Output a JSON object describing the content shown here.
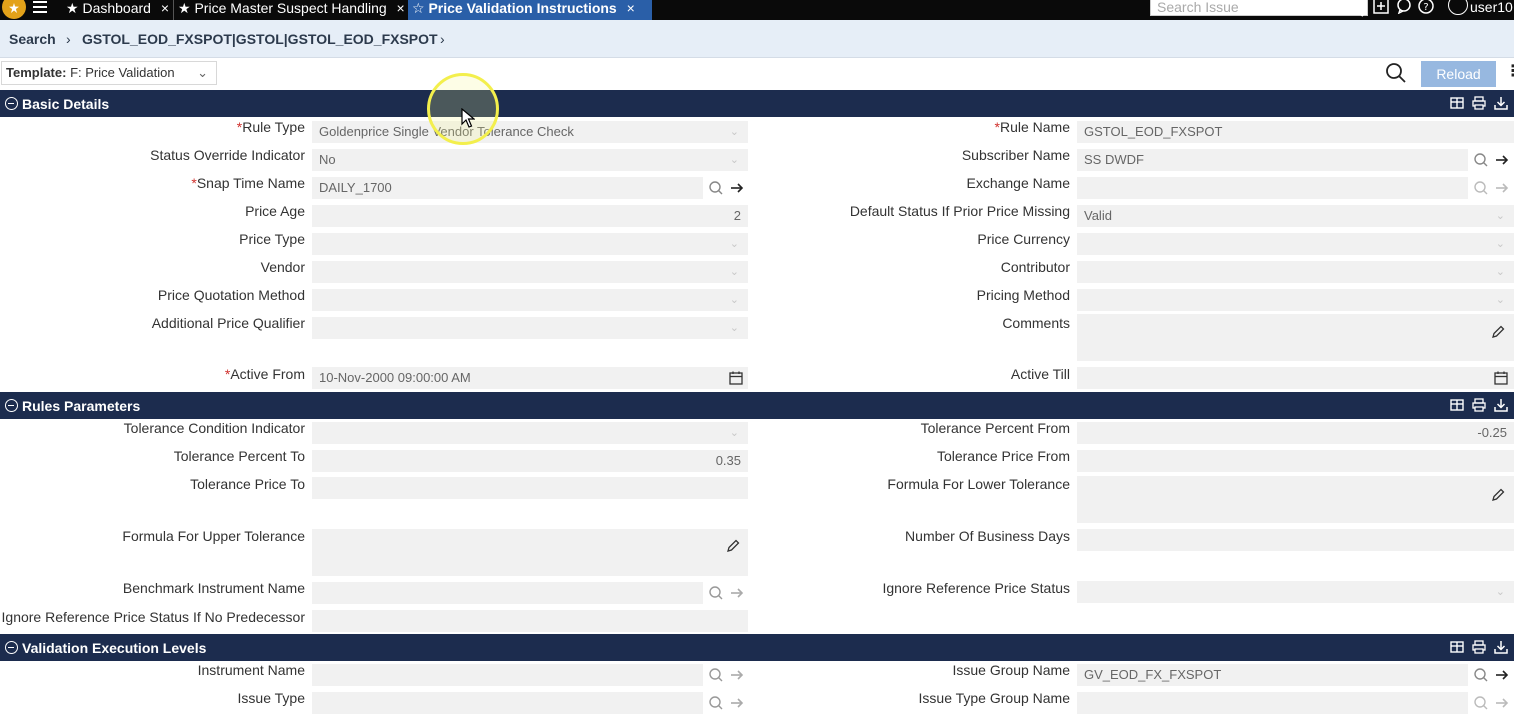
{
  "tabs": [
    {
      "label": "Dashboard",
      "close": "×"
    },
    {
      "label": "Price Master Suspect Handling",
      "close": "×"
    },
    {
      "label": "Price Validation Instructions",
      "close": "×"
    }
  ],
  "topbar": {
    "search_placeholder": "Search Issue",
    "user": "user10"
  },
  "breadcrumb": {
    "root": "Search",
    "current": "GSTOL_EOD_FXSPOT|GSTOL|GSTOL_EOD_FXSPOT"
  },
  "template": {
    "label": "Template:",
    "value": "F: Price Validation"
  },
  "reload_label": "Reload",
  "sections": {
    "basic": "Basic Details",
    "rules": "Rules Parameters",
    "exec": "Validation Execution Levels"
  },
  "basic": {
    "rule_type": {
      "label": "Rule Type",
      "value": "Goldenprice Single Vendor Tolerance Check"
    },
    "status_override": {
      "label": "Status Override Indicator",
      "value": "No"
    },
    "snap_time": {
      "label": "Snap Time Name",
      "value": "DAILY_1700"
    },
    "price_age": {
      "label": "Price Age",
      "value": "2"
    },
    "price_type": {
      "label": "Price Type",
      "value": ""
    },
    "vendor": {
      "label": "Vendor",
      "value": ""
    },
    "price_quotation": {
      "label": "Price Quotation Method",
      "value": ""
    },
    "additional_qualifier": {
      "label": "Additional Price Qualifier",
      "value": ""
    },
    "active_from": {
      "label": "Active From",
      "value": "10-Nov-2000 09:00:00 AM"
    },
    "rule_name": {
      "label": "Rule Name",
      "value": "GSTOL_EOD_FXSPOT"
    },
    "subscriber": {
      "label": "Subscriber Name",
      "value": "SS DWDF"
    },
    "exchange": {
      "label": "Exchange Name",
      "value": ""
    },
    "default_status": {
      "label": "Default Status If Prior Price Missing",
      "value": "Valid"
    },
    "price_currency": {
      "label": "Price Currency",
      "value": ""
    },
    "contributor": {
      "label": "Contributor",
      "value": ""
    },
    "pricing_method": {
      "label": "Pricing Method",
      "value": ""
    },
    "comments": {
      "label": "Comments",
      "value": ""
    },
    "active_till": {
      "label": "Active Till",
      "value": ""
    }
  },
  "rules": {
    "tol_condition": {
      "label": "Tolerance Condition Indicator",
      "value": ""
    },
    "tol_pct_to": {
      "label": "Tolerance Percent To",
      "value": "0.35"
    },
    "tol_price_to": {
      "label": "Tolerance Price To",
      "value": ""
    },
    "formula_upper": {
      "label": "Formula For Upper Tolerance",
      "value": ""
    },
    "benchmark": {
      "label": "Benchmark Instrument Name",
      "value": ""
    },
    "ignore_no_pred": {
      "label": "Ignore Reference Price Status If No Predecessor",
      "value": ""
    },
    "tol_pct_from": {
      "label": "Tolerance Percent From",
      "value": "-0.25"
    },
    "tol_price_from": {
      "label": "Tolerance Price From",
      "value": ""
    },
    "formula_lower": {
      "label": "Formula For Lower Tolerance",
      "value": ""
    },
    "num_bus_days": {
      "label": "Number Of Business Days",
      "value": ""
    },
    "ignore_ref": {
      "label": "Ignore Reference Price Status",
      "value": ""
    }
  },
  "exec": {
    "instrument": {
      "label": "Instrument Name",
      "value": ""
    },
    "issue_type": {
      "label": "Issue Type",
      "value": ""
    },
    "issue_group": {
      "label": "Issue Group Name",
      "value": "GV_EOD_FX_FXSPOT"
    },
    "issue_type_group": {
      "label": "Issue Type Group Name",
      "value": ""
    }
  },
  "required_mark": "*"
}
